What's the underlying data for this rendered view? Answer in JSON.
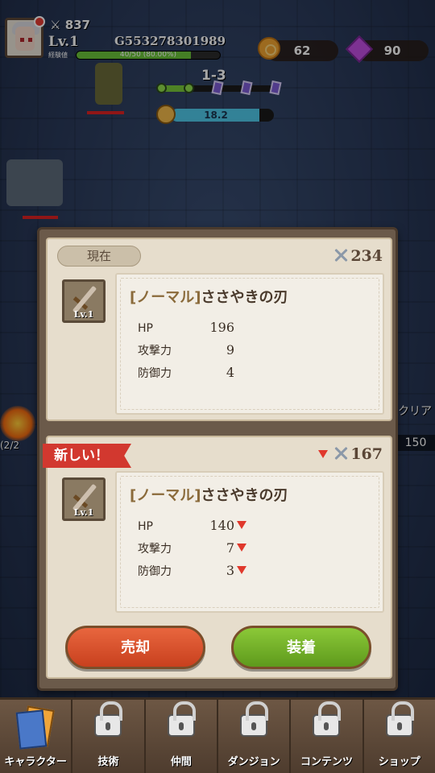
{
  "hud": {
    "power": "837",
    "level": "Lv.1",
    "player_id": "G553278301989",
    "exp_label": "経験値",
    "exp_text": "40/50 (80.00%)",
    "exp_fraction": 0.8,
    "gold": "62",
    "gems": "90",
    "stage": "1-3",
    "timer": "18.2"
  },
  "side": {
    "clear_text": "クリア",
    "count": "150",
    "fraction": "(2/2"
  },
  "dialog": {
    "current": {
      "tag": "現在",
      "power": "234",
      "item_level": "Lv.1",
      "rarity": "[ノーマル]",
      "name": "ささやきの刃",
      "stats": [
        {
          "label": "HP",
          "value": "196"
        },
        {
          "label": "攻撃力",
          "value": "9"
        },
        {
          "label": "防御力",
          "value": "4"
        }
      ]
    },
    "new": {
      "tag": "新しい！",
      "power": "167",
      "item_level": "Lv.1",
      "rarity": "[ノーマル]",
      "name": "ささやきの刃",
      "stats": [
        {
          "label": "HP",
          "value": "140"
        },
        {
          "label": "攻撃力",
          "value": "7"
        },
        {
          "label": "防御力",
          "value": "3"
        }
      ]
    },
    "sell_label": "売却",
    "equip_label": "装着"
  },
  "nav": [
    {
      "label": "キャラクター",
      "icon": "character-cards-icon",
      "locked": false
    },
    {
      "label": "技術",
      "icon": "lock-icon",
      "locked": true
    },
    {
      "label": "仲間",
      "icon": "lock-icon",
      "locked": true
    },
    {
      "label": "ダンジョン",
      "icon": "lock-icon",
      "locked": true
    },
    {
      "label": "コンテンツ",
      "icon": "lock-icon",
      "locked": true
    },
    {
      "label": "ショップ",
      "icon": "lock-icon",
      "locked": true
    }
  ],
  "colors": {
    "sell": "#d2502c",
    "equip": "#76b22a",
    "new_tag": "#d2382f",
    "stat_down": "#e0382c"
  }
}
